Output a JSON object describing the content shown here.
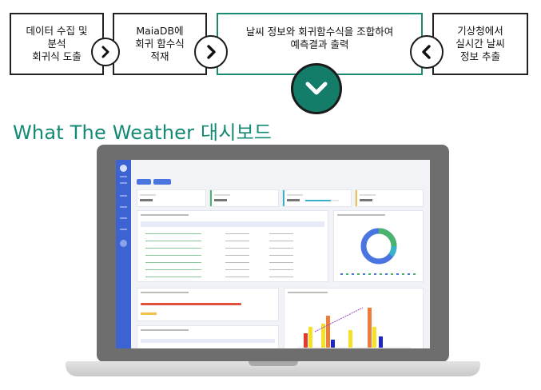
{
  "steps": [
    {
      "label": "데이터 수집 및\n분석\n회귀식 도출"
    },
    {
      "label": "MaiaDB에\n회귀 함수식\n적재"
    },
    {
      "label": "날씨 정보와 회귀함수식을 조합하여\n예측결과 출력"
    },
    {
      "label": "기상청에서\n실시간 날씨\n정보 추출"
    }
  ],
  "connectors": [
    {
      "icon": "chevron-right-icon"
    },
    {
      "icon": "chevron-right-icon"
    },
    {
      "icon": "chevron-left-icon"
    },
    {
      "icon": "chevron-down-icon"
    }
  ],
  "title": "What The Weather 대시보드",
  "colors": {
    "accent": "#138a74",
    "step_active_border": "#1a8a73",
    "dark_circle": "#137d6a",
    "sidebar": "#3d62d1"
  },
  "dashboard": {
    "illustration": "laptop-dashboard-screenshot"
  }
}
